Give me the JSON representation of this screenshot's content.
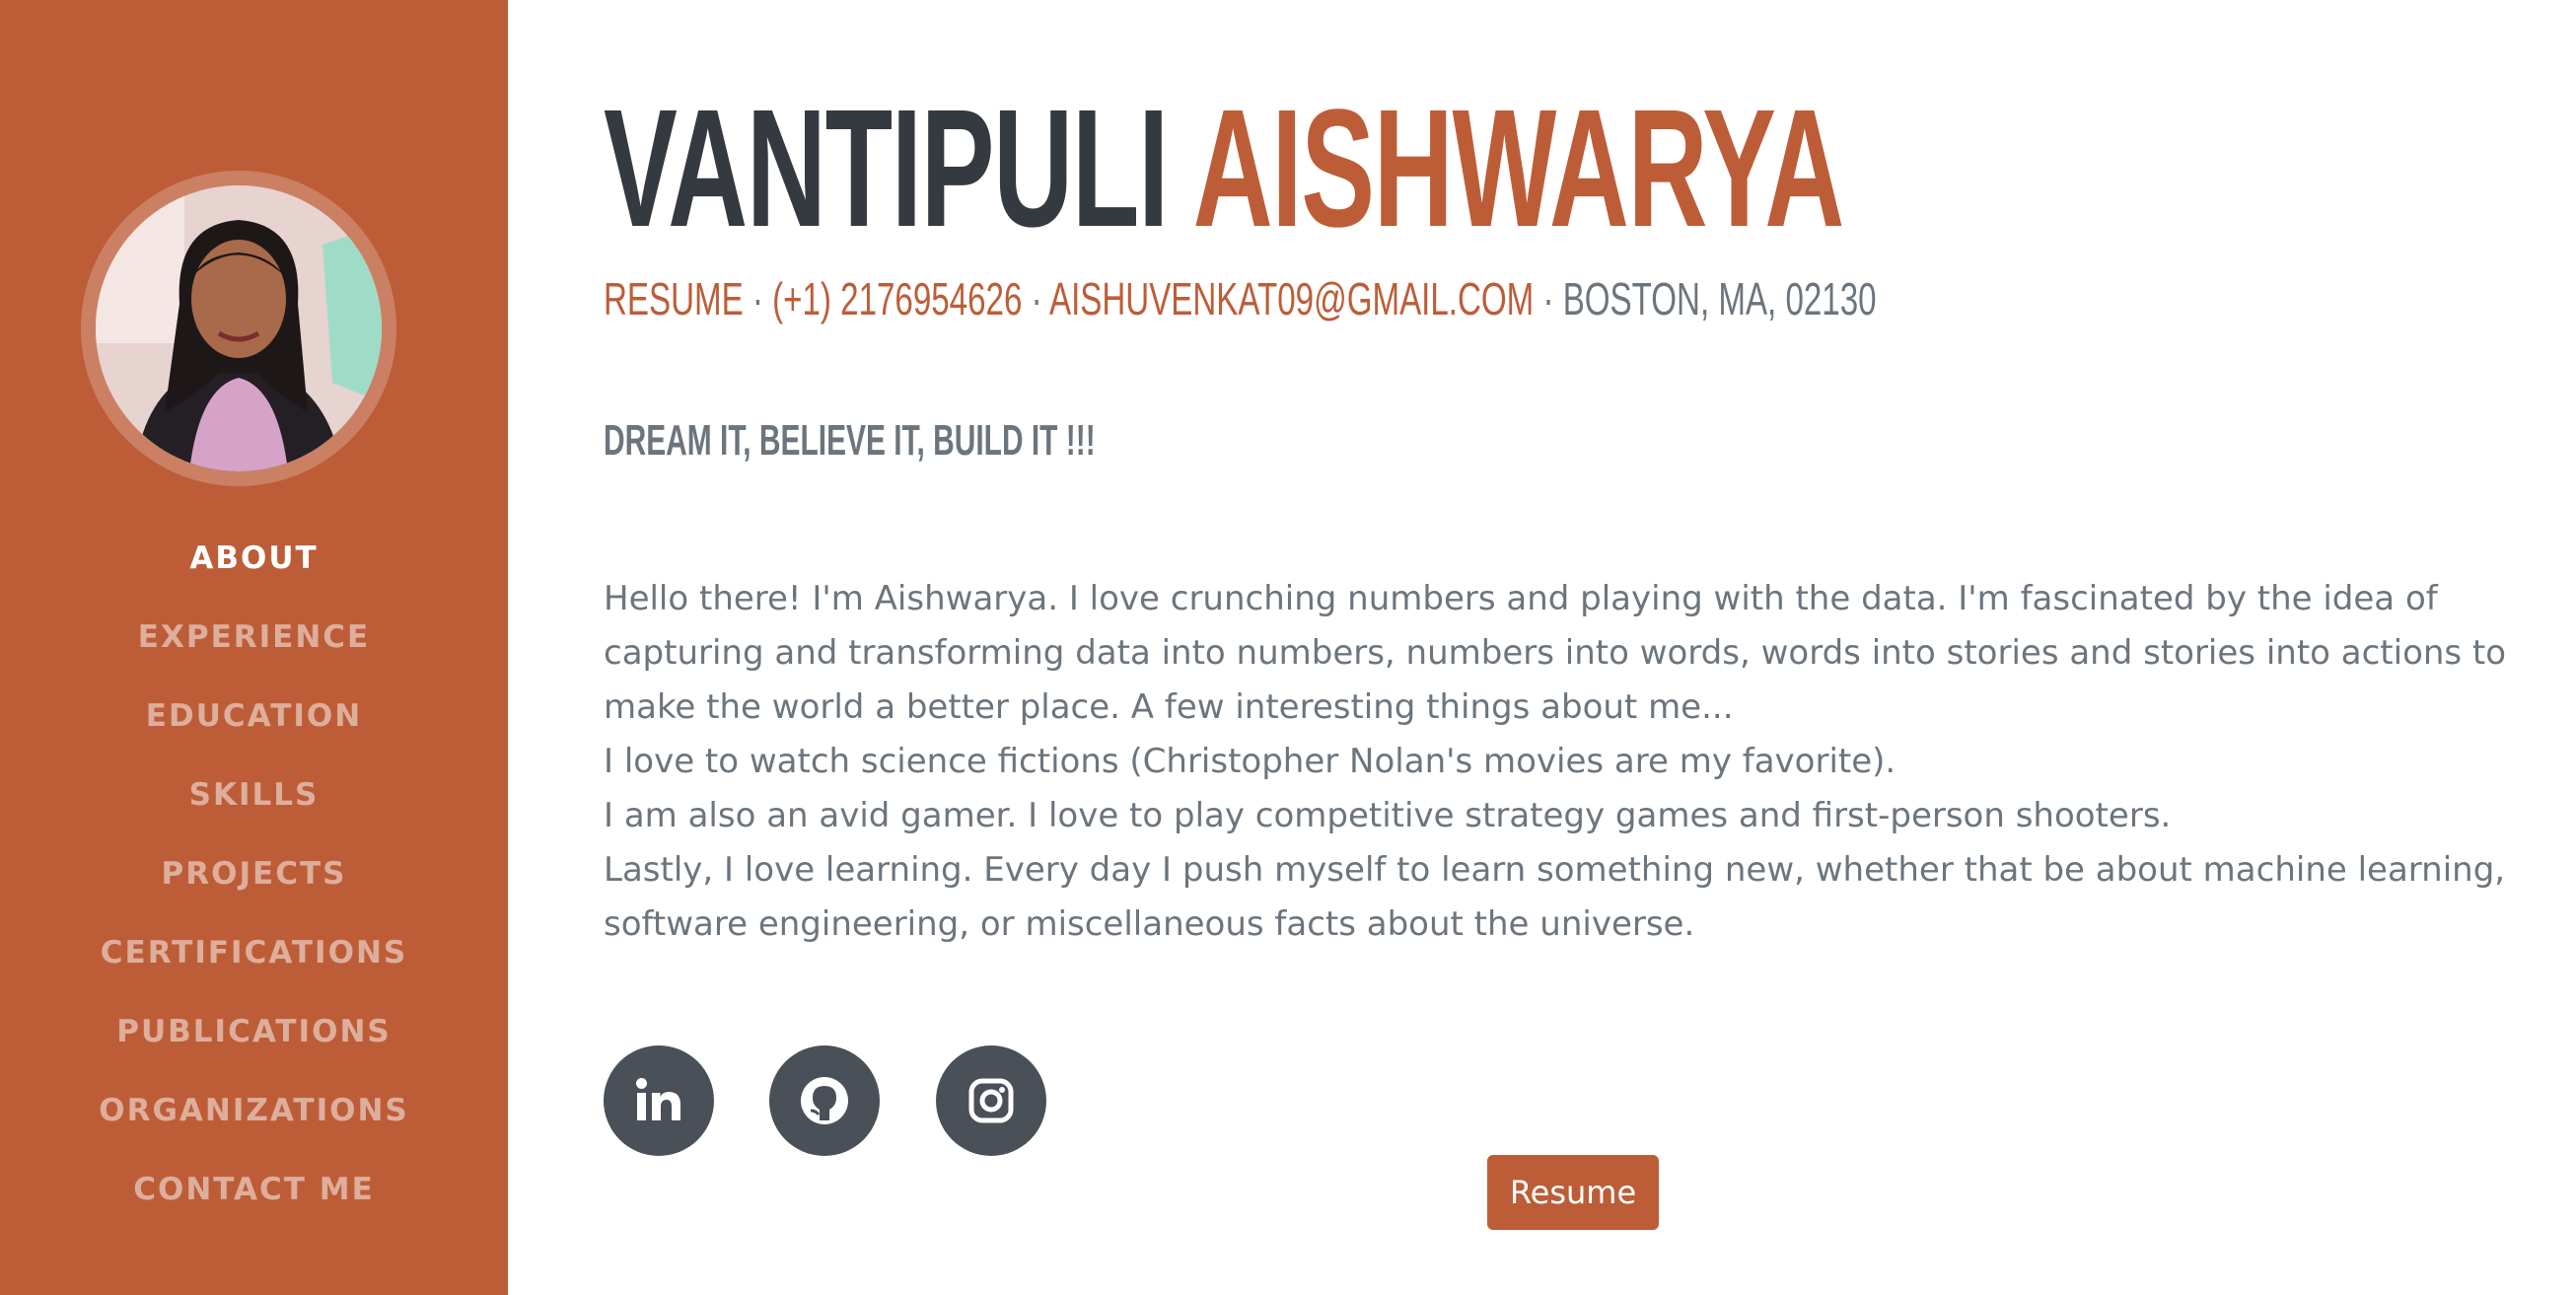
{
  "sidebar": {
    "avatar_alt": "Profile photo",
    "nav": [
      {
        "label": "ABOUT",
        "active": true
      },
      {
        "label": "EXPERIENCE"
      },
      {
        "label": "EDUCATION"
      },
      {
        "label": "SKILLS"
      },
      {
        "label": "PROJECTS"
      },
      {
        "label": "CERTIFICATIONS"
      },
      {
        "label": "PUBLICATIONS"
      },
      {
        "label": "ORGANIZATIONS"
      },
      {
        "label": "CONTACT ME"
      }
    ]
  },
  "header": {
    "first_name": "VANTIPULI",
    "last_name": "AISHWARYA",
    "resume_link": "RESUME",
    "separator": " · ",
    "phone": "(+1) 2176954626",
    "email": "AISHUVENKAT09@GMAIL.COM",
    "location": "BOSTON, MA, 02130"
  },
  "tagline": "DREAM IT, BELIEVE IT, BUILD IT !!!",
  "intro": {
    "p1": "Hello there! I'm Aishwarya. I love crunching numbers and playing with the data. I'm fascinated by the idea of capturing and transforming data into numbers, numbers into words, words into stories and stories into actions to make the world a better place. A few interesting things about me...",
    "p2": "I love to watch science fictions (Christopher Nolan's movies are my favorite).",
    "p3": "I am also an avid gamer. I love to play competitive strategy games and first-person shooters.",
    "p4": "Lastly, I love learning. Every day I push myself to learn something new, whether that be about machine learning, software engineering, or miscellaneous facts about the universe."
  },
  "socials": [
    {
      "icon": "linkedin-icon"
    },
    {
      "icon": "github-icon"
    },
    {
      "icon": "instagram-icon"
    }
  ],
  "resume_button": "Resume",
  "colors": {
    "accent": "#bd5d38",
    "heading": "#343a40",
    "text": "#6c757d",
    "social_bg": "#495057"
  }
}
